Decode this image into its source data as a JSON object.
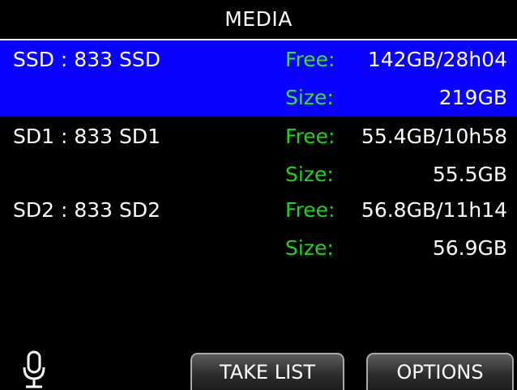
{
  "screen": {
    "title": "MEDIA"
  },
  "media": [
    {
      "name": "SSD : 833 SSD",
      "free_label": "Free:",
      "free_value": "142GB/28h04",
      "size_label": "Size:",
      "size_value": "219GB",
      "selected": true
    },
    {
      "name": "SD1 : 833 SD1",
      "free_label": "Free:",
      "free_value": "55.4GB/10h58",
      "size_label": "Size:",
      "size_value": "55.5GB",
      "selected": false
    },
    {
      "name": "SD2 : 833 SD2",
      "free_label": "Free:",
      "free_value": "56.8GB/11h14",
      "size_label": "Size:",
      "size_value": "56.9GB",
      "selected": false
    }
  ],
  "softkeys": {
    "take_list": "TAKE LIST",
    "options": "OPTIONS"
  },
  "status": {
    "icon": "microphone-icon"
  },
  "colors": {
    "background": "#000000",
    "selected_row": "#0a00ff",
    "field_label": "#1fd41f",
    "text": "#ffffff"
  }
}
